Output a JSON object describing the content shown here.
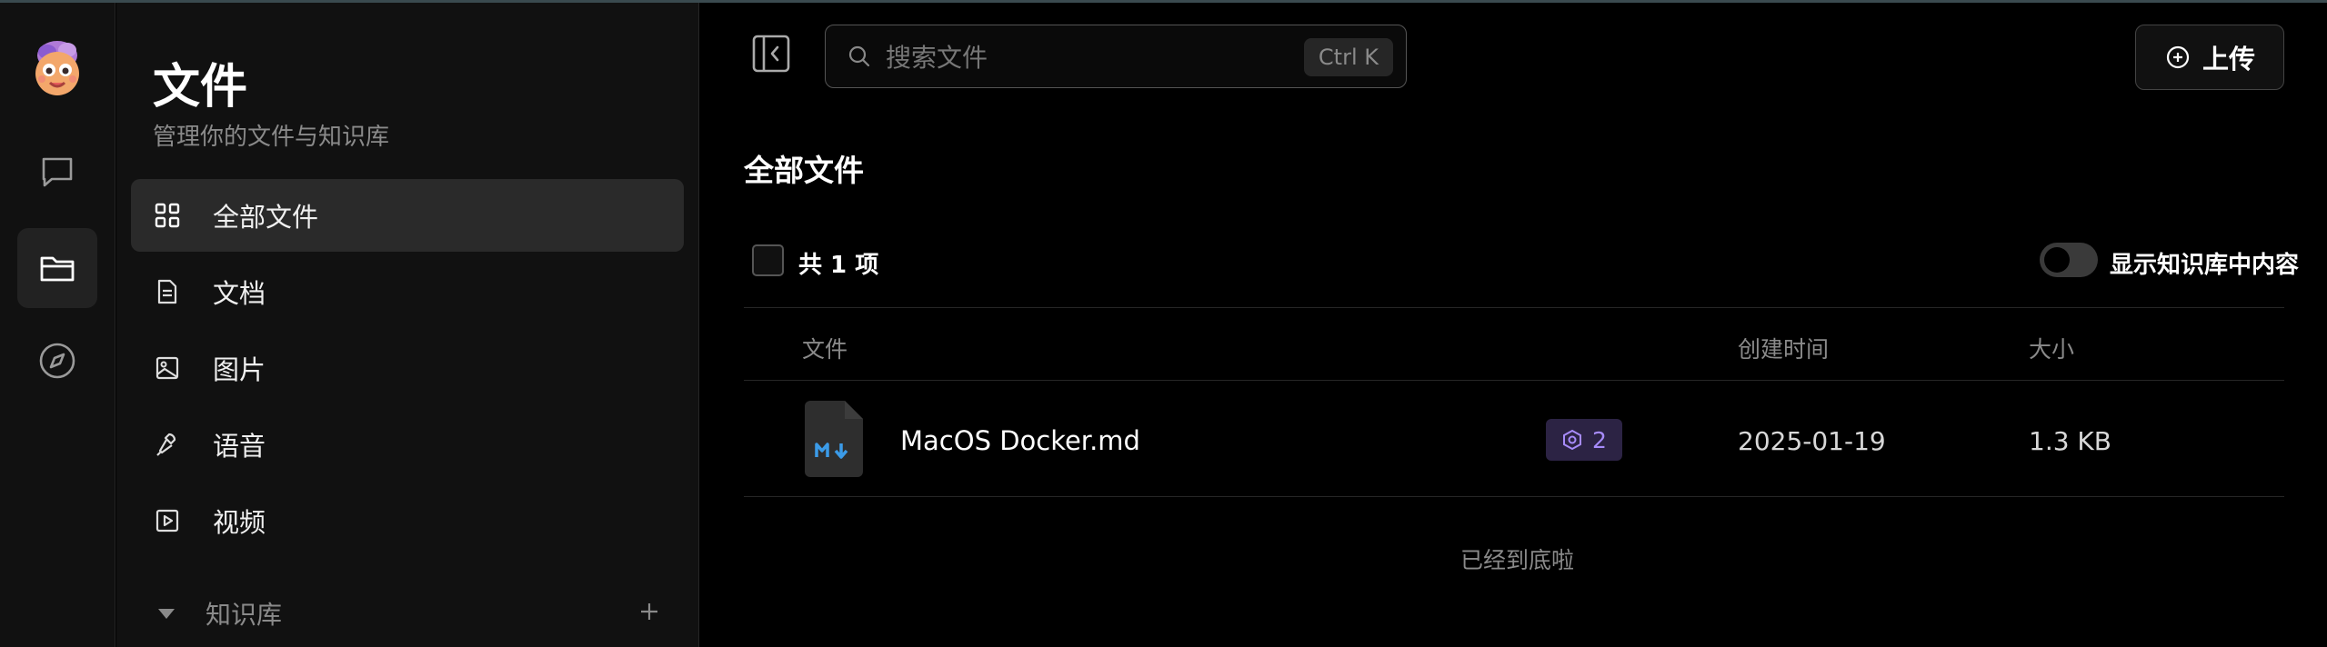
{
  "sidebar": {
    "title": "文件",
    "subtitle": "管理你的文件与知识库",
    "items": [
      {
        "label": "全部文件",
        "icon": "grid-icon",
        "active": true
      },
      {
        "label": "文档",
        "icon": "document-icon",
        "active": false
      },
      {
        "label": "图片",
        "icon": "image-icon",
        "active": false
      },
      {
        "label": "语音",
        "icon": "microphone-icon",
        "active": false
      },
      {
        "label": "视频",
        "icon": "video-icon",
        "active": false
      }
    ],
    "knowledge_base": {
      "label": "知识库",
      "icon": "plus-icon"
    }
  },
  "search": {
    "placeholder": "搜索文件",
    "shortcut": "Ctrl K"
  },
  "upload": {
    "label": "上传"
  },
  "main": {
    "heading": "全部文件",
    "count_label": "共 1 项",
    "toggle_label": "显示知识库中内容",
    "toggle_on": false,
    "columns": [
      "文件",
      "创建时间",
      "大小"
    ],
    "rows": [
      {
        "name": "MacOS Docker.md",
        "chunks": "2",
        "created": "2025-01-19",
        "size": "1.3 KB",
        "icon": "markdown-file-icon"
      }
    ],
    "end_text": "已经到底啦"
  },
  "colors": {
    "accent_purple": "#a78bfa",
    "badge_bg": "#2c2344",
    "markdown_blue": "#3b9be8"
  }
}
